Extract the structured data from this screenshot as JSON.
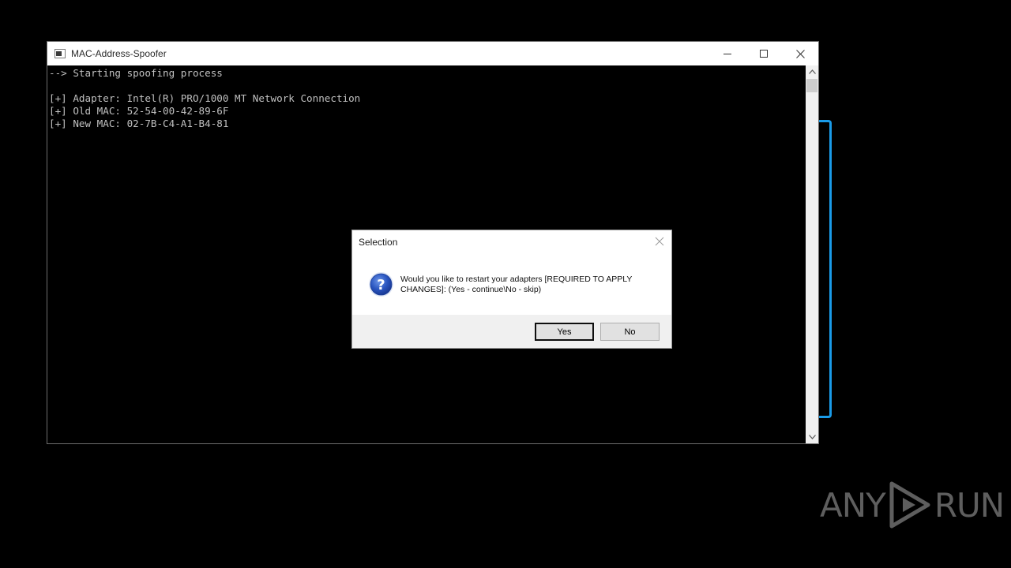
{
  "console_window": {
    "title": "MAC-Address-Spoofer",
    "controls": {
      "minimize": "minimize-icon",
      "maximize": "maximize-icon",
      "close": "close-icon"
    },
    "lines": [
      "--> Starting spoofing process",
      "",
      "[+] Adapter: Intel(R) PRO/1000 MT Network Connection",
      "[+] Old MAC: 52-54-00-42-89-6F",
      "[+] New MAC: 02-7B-C4-A1-B4-81"
    ]
  },
  "dialog": {
    "title": "Selection",
    "icon": "question-icon",
    "message_line1": "Would you like to restart your adapters [REQUIRED TO APPLY",
    "message_line2": "CHANGES]: (Yes - continue\\No - skip)",
    "yes_label": "Yes",
    "no_label": "No"
  },
  "watermark": {
    "left": "ANY",
    "right": "RUN"
  },
  "colors": {
    "console_text": "#c0c0c0",
    "background_window_frame": "#1a9be8",
    "watermark": "#5e5e5e"
  }
}
